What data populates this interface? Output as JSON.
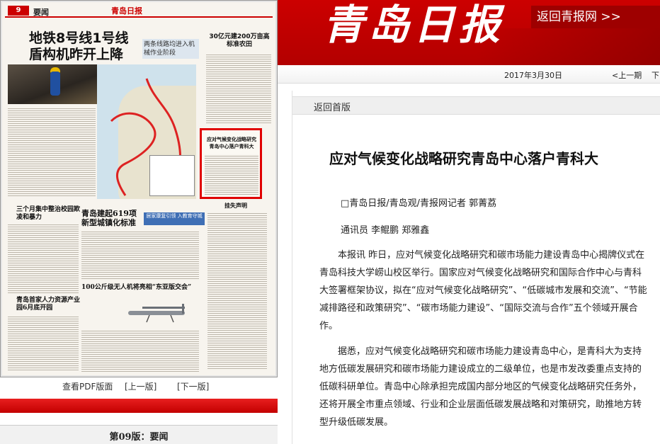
{
  "left": {
    "edition_number": "9",
    "edition_name": "要闻",
    "paper_logo": "青岛日报",
    "headline_line1": "地铁8号线1号线",
    "headline_line2": "盾构机昨开上降",
    "sub_head": "两条线路均进入机械作业阶段",
    "right_col_head": "30亿元建200万亩高标准农田",
    "highlight_title": "应对气候变化战略研究青岛中心落户青科大",
    "section2_head": "三个月集中整治校园欺凌和暴力",
    "section3_head": "青岛建起619项新型城镇化标准",
    "blue_tag": "居家康复引领 入教育守城",
    "section4_head": "100公斤级无人机将亮相“东亚版交会”",
    "section5_head": "青岛首家人力资源产业园6月底开园",
    "notice_head": "挂失声明",
    "view_pdf": "查看PDF版面",
    "prev_page": "[上一版]",
    "next_page": "[下一版]",
    "edition_footer": "第09版：要闻"
  },
  "header": {
    "logo": "青岛日报",
    "back_button": "返回青报网 >>",
    "date": "2017年3月30日",
    "prev_issue": "<上一期",
    "next_issue": "下"
  },
  "article": {
    "back_home": "返回首版",
    "title": "应对气候变化战略研究青岛中心落户青科大",
    "byline1": "□青岛日报/青岛观/青报网记者 郭菁荔",
    "byline2": "通讯员 李鲲鹏 郑雅鑫",
    "para1": "本报讯 昨日，应对气候变化战略研究和碳市场能力建设青岛中心揭牌仪式在青岛科技大学崂山校区举行。国家应对气候变化战略研究和国际合作中心与青科大签署框架协议，拟在“应对气候变化战略研究”、“低碳城市发展和交流”、“节能减排路径和政策研究”、“碳市场能力建设”、“国际交流与合作”五个领域开展合作。",
    "para2": "据悉，应对气候变化战略研究和碳市场能力建设青岛中心，是青科大为支持地方低碳发展研究和碳市场能力建设成立的二级单位，也是市发改委重点支持的低碳科研单位。青岛中心除承担完成国内部分地区的气候变化战略研究任务外，还将开展全市重点领域、行业和企业层面低碳发展战略和对策研究，助推地方转型升级低碳发展。"
  },
  "colors": {
    "brand_red": "#c00000",
    "highlight_red": "#e00000",
    "tag_blue": "#3f6fb5"
  }
}
